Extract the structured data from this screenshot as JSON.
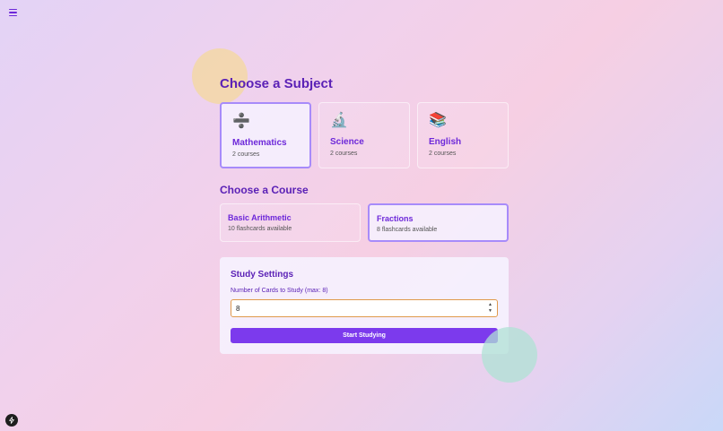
{
  "menu": {
    "icon": "hamburger-menu-icon"
  },
  "subjects": {
    "title": "Choose a Subject",
    "items": [
      {
        "icon": "➗",
        "icon_name": "division-icon",
        "name": "Mathematics",
        "count": "2 courses",
        "selected": true
      },
      {
        "icon": "🔬",
        "icon_name": "microscope-icon",
        "name": "Science",
        "count": "2 courses",
        "selected": false
      },
      {
        "icon": "📚",
        "icon_name": "books-icon",
        "name": "English",
        "count": "2 courses",
        "selected": false
      }
    ]
  },
  "courses": {
    "title": "Choose a Course",
    "items": [
      {
        "name": "Basic Arithmetic",
        "count": "10 flashcards available",
        "selected": false
      },
      {
        "name": "Fractions",
        "count": "8 flashcards available",
        "selected": true
      }
    ]
  },
  "settings": {
    "title": "Study Settings",
    "label": "Number of Cards to Study (max: 8)",
    "value": "8",
    "start_label": "Start Studying"
  },
  "bottom": {
    "icon": "bolt-icon"
  },
  "colors": {
    "accent": "#7c3aed",
    "heading": "#5b21b6",
    "selected_border": "#a78bfa",
    "input_border": "#e09a4c"
  }
}
